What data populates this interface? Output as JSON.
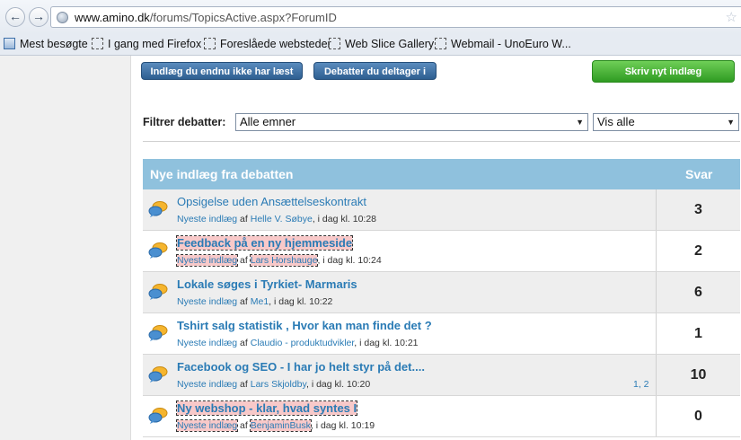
{
  "browser": {
    "url_domain": "www.amino.dk",
    "url_path": "/forums/TopicsActive.aspx?ForumID",
    "bookmarks": [
      {
        "label": "Mest besøgte",
        "icon": "most-visited-icon"
      },
      {
        "label": "I gang med Firefox",
        "icon": "page-icon"
      },
      {
        "label": "Foreslåede websteder",
        "icon": "page-icon"
      },
      {
        "label": "Web Slice Gallery",
        "icon": "page-icon"
      },
      {
        "label": "Webmail - UnoEuro W...",
        "icon": "page-icon"
      }
    ]
  },
  "toolbar": {
    "unread_label": "Indlæg du endnu ikke har læst",
    "participating_label": "Debatter du deltager i",
    "new_post_label": "Skriv nyt indlæg"
  },
  "filter": {
    "label": "Filtrer debatter:",
    "topic_select": "Alle emner",
    "view_select": "Vis alle"
  },
  "table": {
    "header_title": "Nye indlæg fra debatten",
    "header_replies": "Svar",
    "rows": [
      {
        "title": "Opsigelse uden Ansættelseskontrakt",
        "latest": "Nyeste indlæg",
        "by": "af",
        "author": "Helle V. Søbye",
        "time": ", i dag kl. 10:28",
        "replies": "3",
        "pages": ""
      },
      {
        "title": "Feedback på en ny hjemmeside",
        "latest": "Nyeste indlæg",
        "by": "af",
        "author": "Lars Horshauge",
        "time": ", i dag kl. 10:24",
        "replies": "2",
        "pages": ""
      },
      {
        "title": "Lokale søges i Tyrkiet- Marmaris",
        "latest": "Nyeste indlæg",
        "by": "af",
        "author": "Me1",
        "time": ", i dag kl. 10:22",
        "replies": "6",
        "pages": ""
      },
      {
        "title": "Tshirt salg statistik , Hvor kan man finde det ?",
        "latest": "Nyeste indlæg",
        "by": "af",
        "author": "Claudio - produktudvikler",
        "time": ", i dag kl. 10:21",
        "replies": "1",
        "pages": ""
      },
      {
        "title": "Facebook og SEO - I har jo helt styr på det....",
        "latest": "Nyeste indlæg",
        "by": "af",
        "author": "Lars Skjoldby",
        "time": ", i dag kl. 10:20",
        "replies": "10",
        "pages": "1, 2"
      },
      {
        "title": "Ny webshop - klar, hvad syntes I",
        "latest": "Nyeste indlæg",
        "by": "af",
        "author": "BenjaminBusk",
        "time": ", i dag kl. 10:19",
        "replies": "0",
        "pages": ""
      }
    ]
  }
}
